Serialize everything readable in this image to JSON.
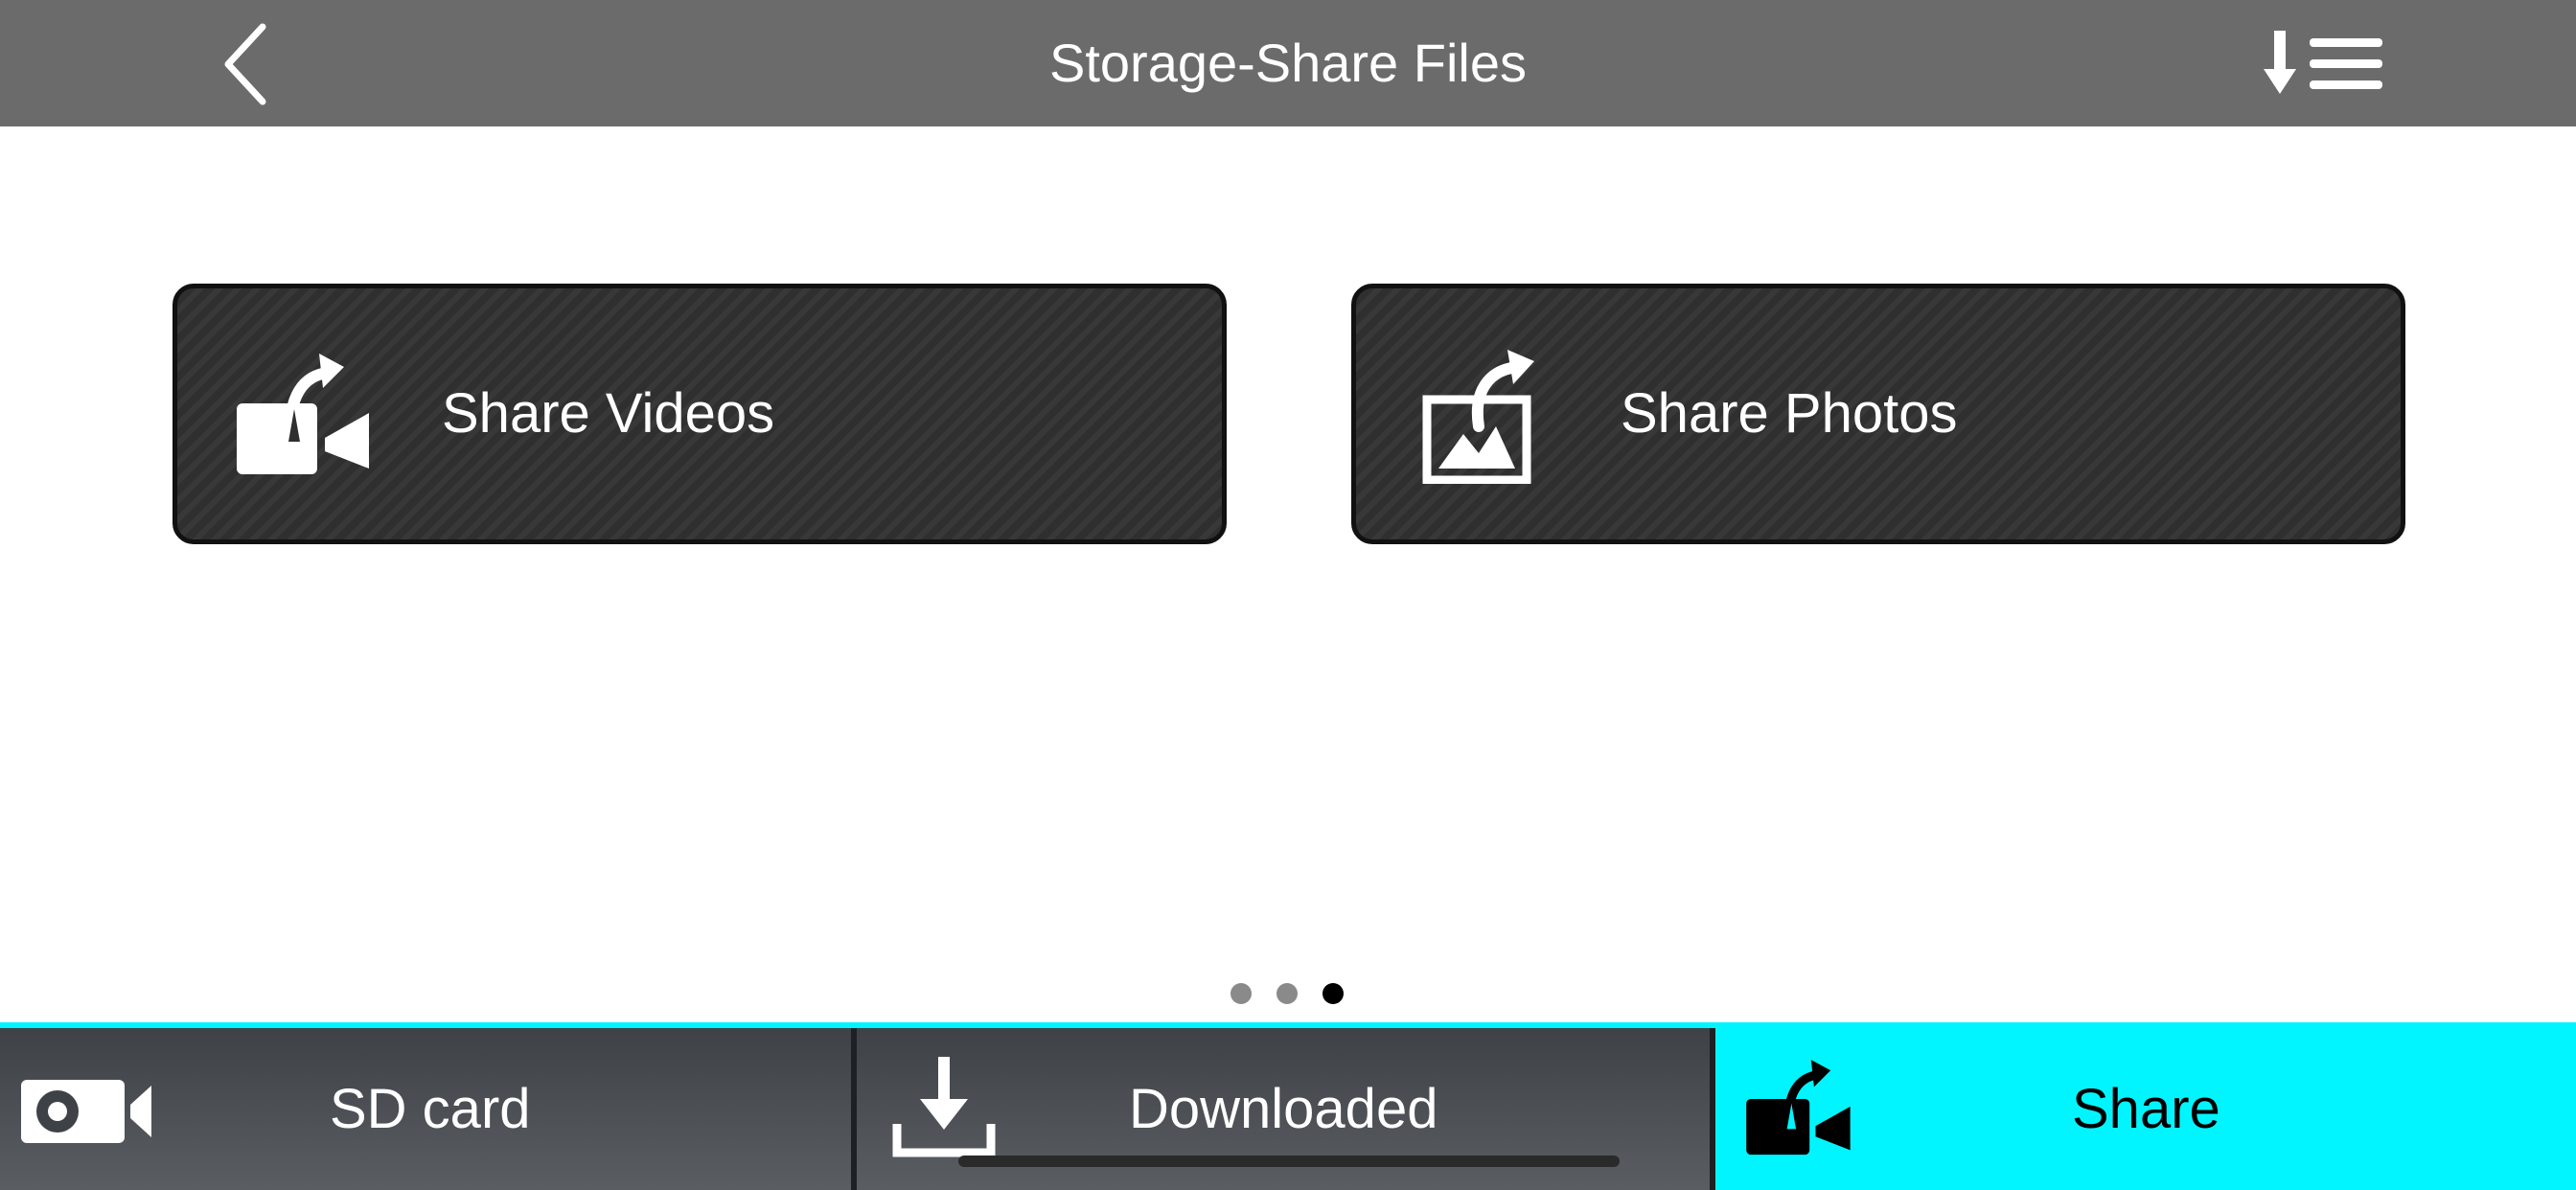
{
  "header": {
    "title": "Storage-Share Files",
    "back_icon": "chevron-left-icon",
    "sort_icon": "sort-list-icon"
  },
  "cards": [
    {
      "label": "Share Videos",
      "icon": "share-video-icon"
    },
    {
      "label": "Share Photos",
      "icon": "share-photo-icon"
    }
  ],
  "pager": {
    "total": 3,
    "active": 3
  },
  "tabs": [
    {
      "label": "SD card",
      "icon": "sd-camera-icon",
      "selected": false
    },
    {
      "label": "Downloaded",
      "icon": "download-icon",
      "selected": false
    },
    {
      "label": "Share",
      "icon": "share-video-icon",
      "selected": true
    }
  ],
  "colors": {
    "header_bg": "#6b6b6b",
    "accent": "#00f5ff",
    "card_bg": "#2f2f2f",
    "tab_bg": "#4a4e53"
  }
}
